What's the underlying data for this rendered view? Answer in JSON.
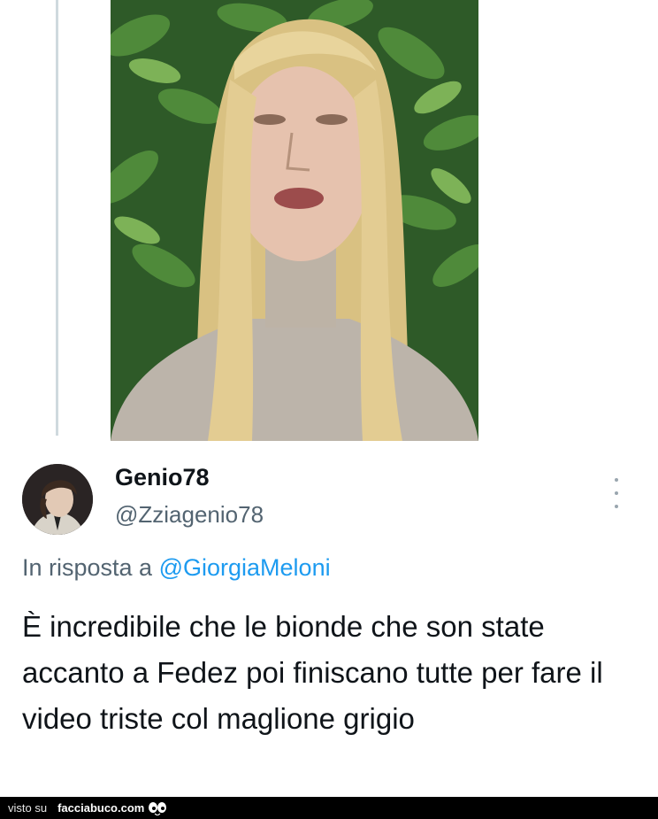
{
  "tweet": {
    "author": {
      "display_name": "Genio78",
      "handle": "@Zziagenio78"
    },
    "reply_to": {
      "prefix": "In risposta a",
      "mention": "@GiorgiaMeloni"
    },
    "text": "È incredibile che le bionde che son state accanto a Fedez poi finiscano tutte per fare il video triste col maglione grigio"
  },
  "footer": {
    "prefix": "visto su",
    "brand": "facciabuco.com"
  },
  "icons": {
    "menu": "more-vertical-icon",
    "logo": "eyes-icon"
  },
  "colors": {
    "link": "#1d9bf0",
    "secondary_text": "#536471",
    "primary_text": "#0f1419"
  }
}
